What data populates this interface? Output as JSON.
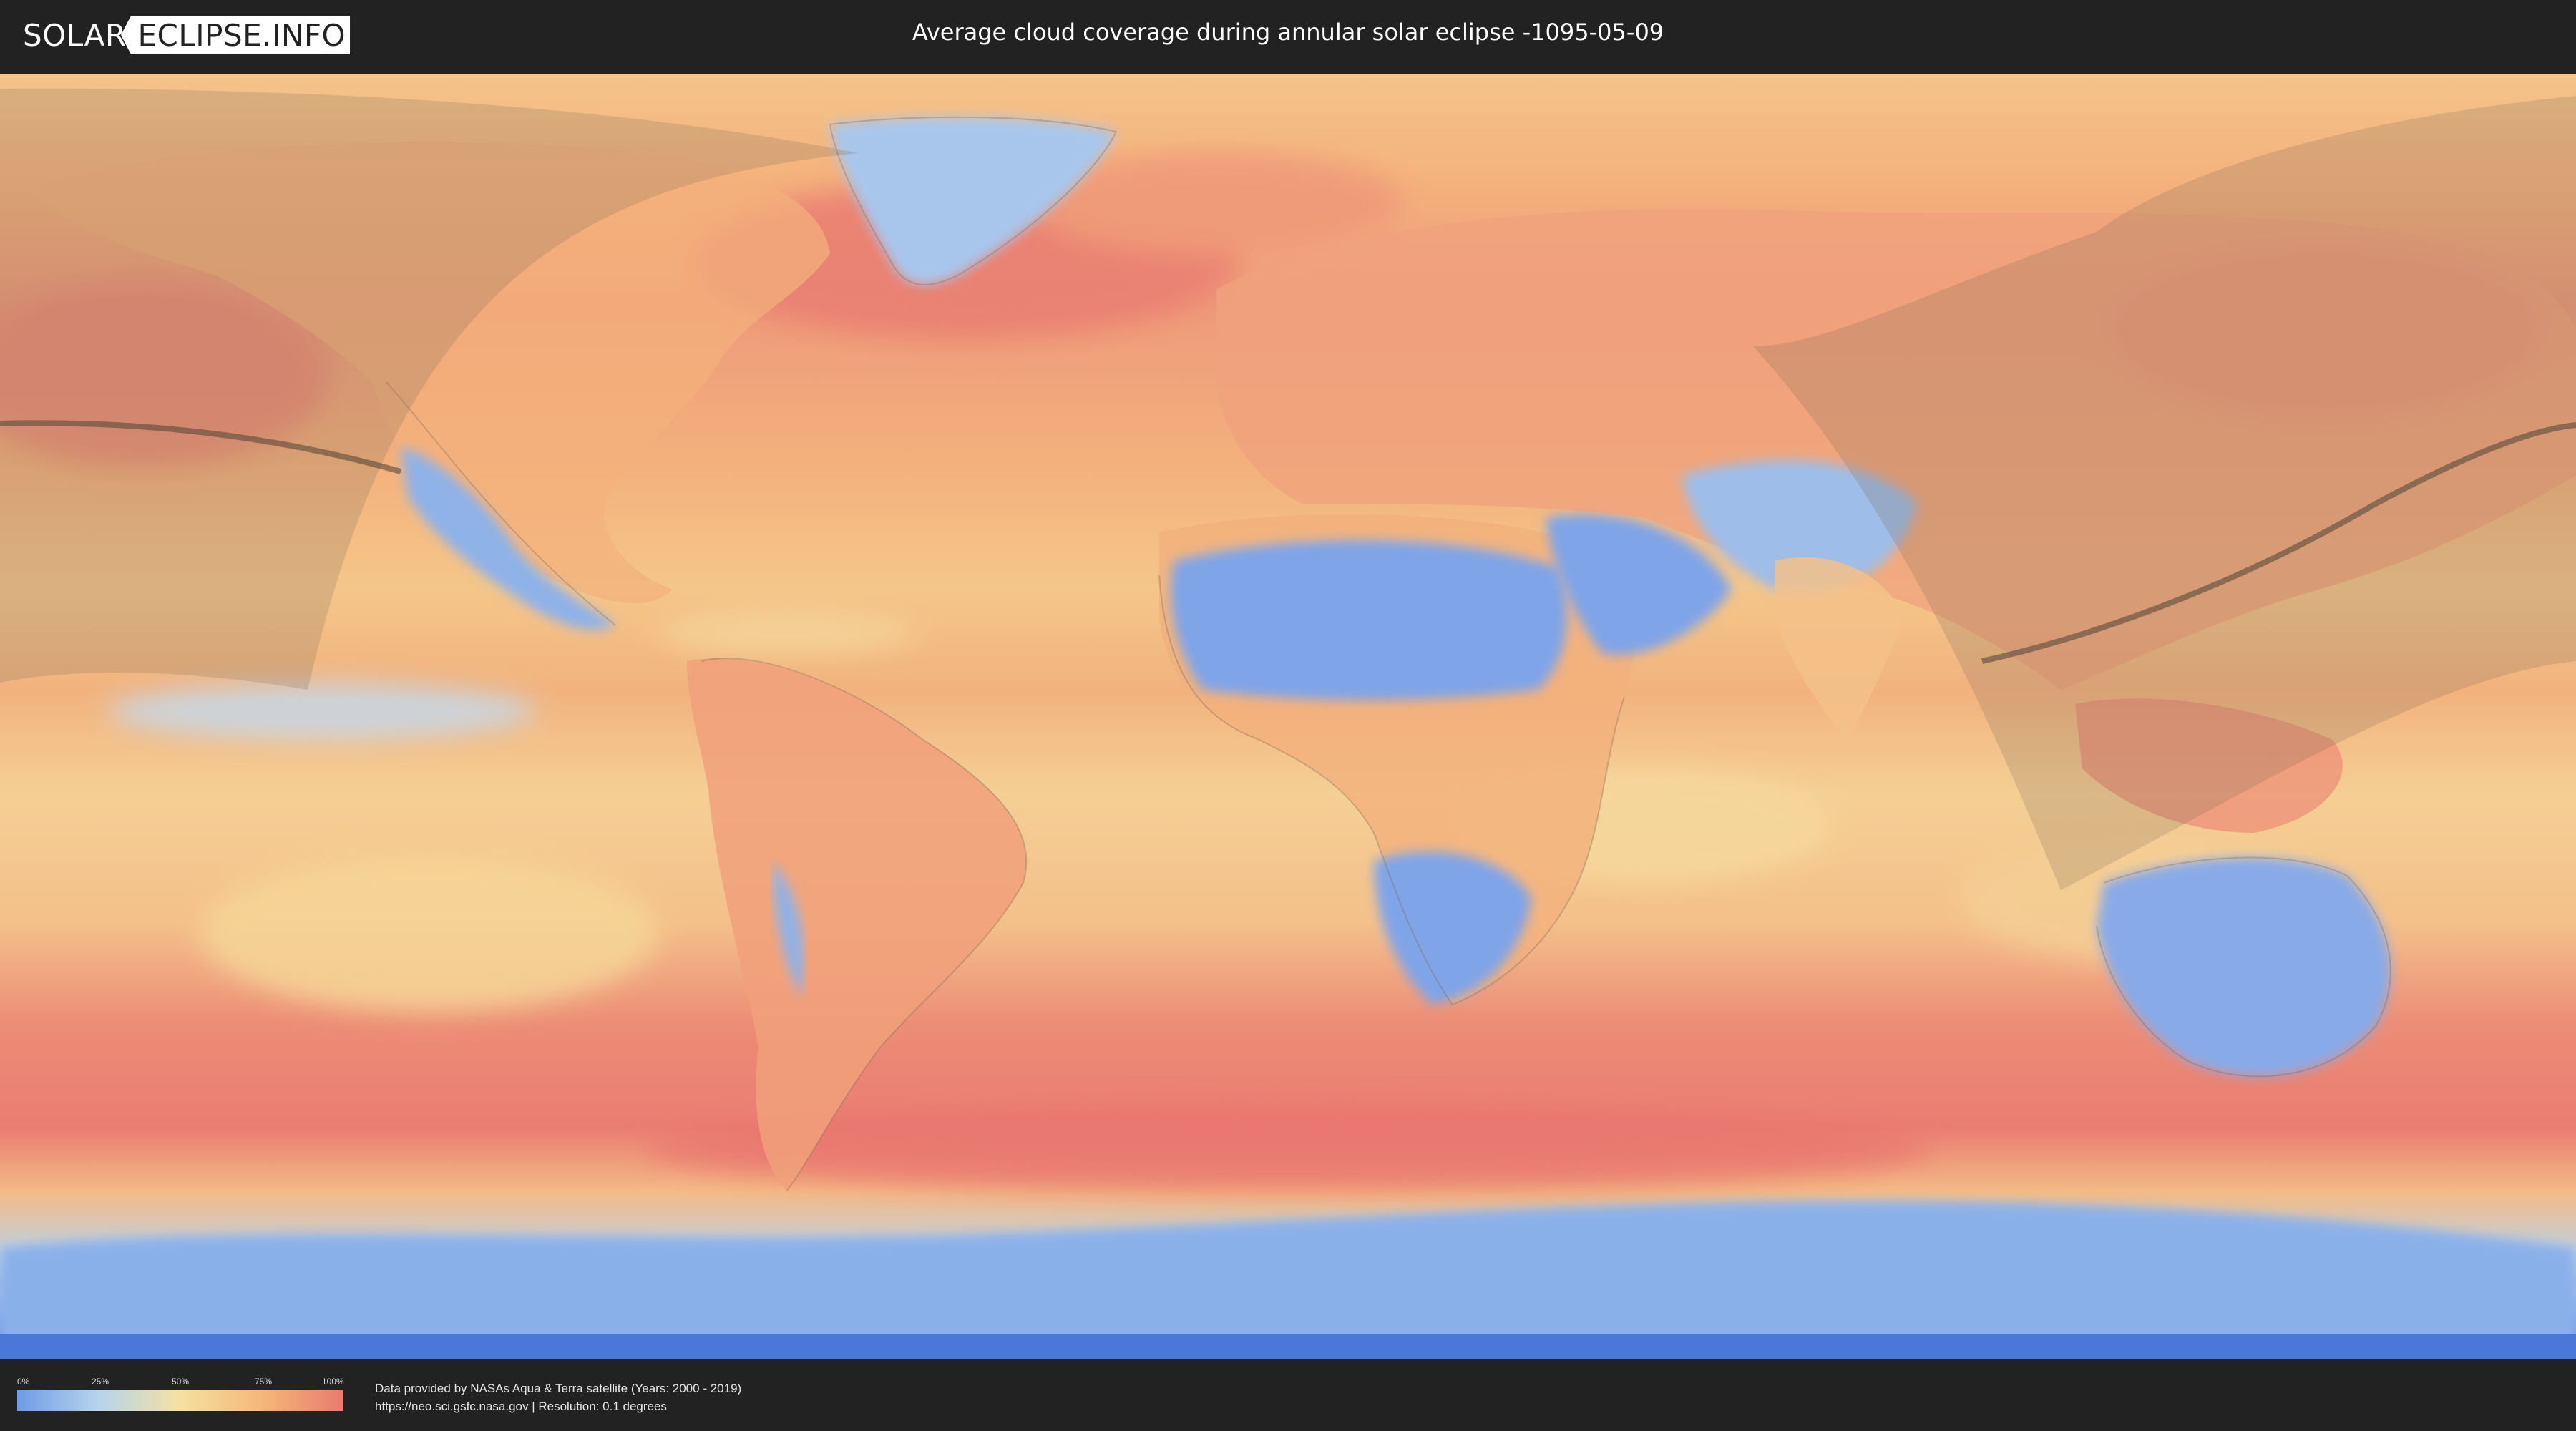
{
  "header": {
    "logo_left": "SOLAR",
    "logo_right": "ECLIPSE.INFO",
    "title": "Average cloud coverage during annular solar eclipse -1095-05-09"
  },
  "map": {
    "layer": "average cloud coverage",
    "colors": {
      "clear": "#6f9be6",
      "low": "#b6d4ea",
      "mid": "#f5e0a2",
      "high": "#f4b878",
      "overcast": "#ea7a70",
      "penumbra_shade": "#7a6a55",
      "path_line": "#5a4a3a"
    }
  },
  "legend": {
    "ticks": [
      "0%",
      "25%",
      "50%",
      "75%",
      "100%"
    ]
  },
  "credits": {
    "line1": "Data provided by NASAs Aqua & Terra satellite (Years: 2000 - 2019)",
    "line2": "https://neo.sci.gsfc.nasa.gov | Resolution: 0.1 degrees"
  }
}
